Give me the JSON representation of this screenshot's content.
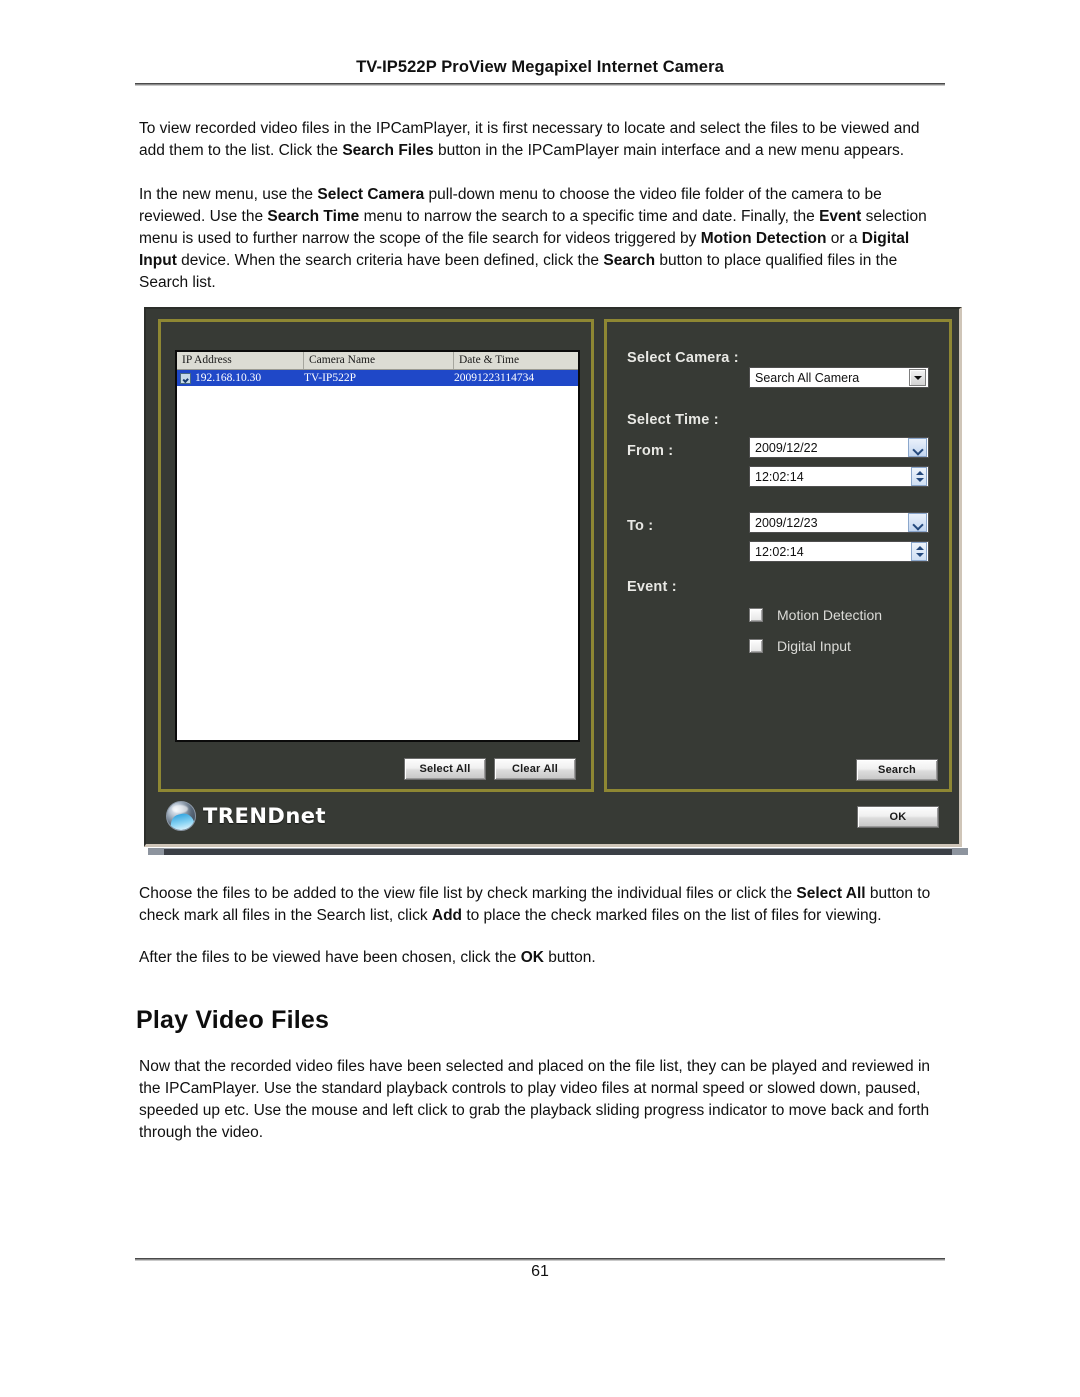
{
  "header": {
    "title": "TV-IP522P ProView Megapixel Internet Camera"
  },
  "footer": {
    "page_number": "61"
  },
  "body": {
    "paragraph_1_html": "To view recorded video files in the IPCamPlayer, it is first necessary to locate and select the files to be viewed and add them to the list. Click the <b>Search Files</b> button in the IPCamPlayer main interface and a new menu appears.",
    "paragraph_2_html": "In the new menu, use the <b>Select Camera</b> pull-down menu to choose the video file folder of the camera to be reviewed. Use the <b>Search Time</b> menu to narrow the search to a specific time and date. Finally, the <b>Event</b> selection menu is used to further narrow the scope of the file search for videos triggered by <b>Motion Detection</b> or a <b>Digital Input</b> device. When the search criteria have been defined, click the <b>Search</b> button to place qualified files in the Search list.",
    "paragraph_3_html": "Choose the files to be added to the view file list by check marking the individual files or click the <b>Select All</b> button to check mark all files in the Search list, click <b>Add</b> to place the check marked files on the list of files for viewing.",
    "paragraph_4_html": "After the files to be viewed have been chosen, click the <b>OK</b> button.",
    "section_heading": "Play Video Files",
    "paragraph_5_html": "Now that the recorded video files have been selected and placed on the file list, they can be played and reviewed in the IPCamPlayer.  Use the standard playback controls to play video files at normal speed or slowed down, paused, speeded up etc. Use the mouse and left click to grab the playback sliding progress indicator to move back and forth through the video."
  },
  "dialog": {
    "file_list": {
      "columns": [
        "IP Address",
        "Camera Name",
        "Date & Time"
      ],
      "rows": [
        {
          "checked": true,
          "ip_address": "192.168.10.30",
          "camera_name": "TV-IP522P",
          "date_time": "20091223114734"
        }
      ]
    },
    "buttons": {
      "select_all": "Select All",
      "clear_all": "Clear All",
      "search": "Search",
      "ok": "OK"
    },
    "labels": {
      "select_camera": "Select Camera :",
      "select_time": "Select Time :",
      "from": "From :",
      "to": "To :",
      "event": "Event :"
    },
    "fields": {
      "camera_value": "Search All Camera",
      "from_date": "2009/12/22",
      "from_time": "12:02:14",
      "to_date": "2009/12/23",
      "to_time": "12:02:14"
    },
    "event_options": [
      {
        "label": "Motion Detection",
        "checked": false
      },
      {
        "label": "Digital Input",
        "checked": false
      }
    ],
    "brand": "TRENDnet",
    "colors": {
      "dialog_background": "#373a35",
      "groupbox_border": "#8e8733",
      "selection_blue": "#1f48c8",
      "label_text": "#e8e8e4"
    }
  }
}
